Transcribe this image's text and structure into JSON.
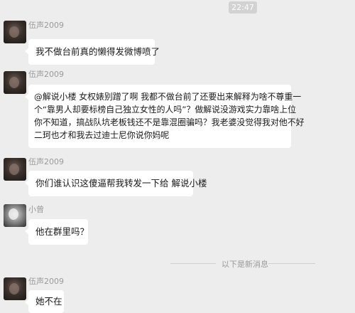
{
  "time": "22:47",
  "messages": [
    {
      "sender": "伍声2009",
      "lines": [
        "我不做台前真的懒得发微博喷了"
      ]
    },
    {
      "sender": "伍声2009",
      "lines": [
        "@解说小楼 女权婊别蹭了啊 我都不做台前了还要出来解释为啥不尊重一",
        "个“靠男人却要标榜自己独立女性的人吗”？做解说没游戏实力靠啥上位",
        "你不知道，搞战队坑老板钱还不是靠混圈骗吗？我老婆没觉得我对他不好",
        "二珂也才和我去过迪士尼你说你妈呢"
      ]
    },
    {
      "sender": "伍声2009",
      "lines": [
        "你们谁认识这傻逼帮我转发一下给 解说小楼"
      ]
    },
    {
      "sender": "小曾",
      "lines": [
        "他在群里吗？"
      ]
    },
    {
      "sender": "伍声2009",
      "lines": [
        "她不在"
      ]
    }
  ],
  "new_messages_divider": "以下是新消息"
}
